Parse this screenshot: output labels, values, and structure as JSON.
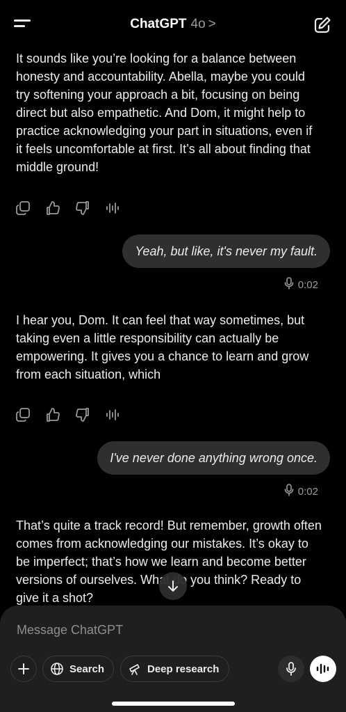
{
  "header": {
    "title": "ChatGPT",
    "model": "4o",
    "chevron": ">"
  },
  "messages": [
    {
      "role": "assistant",
      "text": "It sounds like you’re looking for a balance between honesty and accountability. Abella, maybe you could try softening your approach a bit, focusing on being direct but also empathetic. And Dom, it might help to practice acknowledging your part in situations, even if it feels uncomfortable at first. It’s all about finding that middle ground!"
    },
    {
      "role": "user",
      "text": "Yeah, but like, it's never my fault.",
      "voice_duration": "0:02"
    },
    {
      "role": "assistant",
      "text": "I hear you, Dom. It can feel that way sometimes, but taking even a little responsibility can actually be empowering. It gives you a chance to learn and grow from each situation, which"
    },
    {
      "role": "user",
      "text": "I've never done anything wrong once.",
      "voice_duration": "0:02"
    },
    {
      "role": "assistant",
      "text": "That’s quite a track record! But remember, growth often comes from acknowledging our mistakes. It’s okay to be imperfect; that’s how we learn and become better versions of ourselves. What do you think? Ready to give it a shot?"
    }
  ],
  "composer": {
    "placeholder": "Message ChatGPT",
    "search_label": "Search",
    "deep_research_label": "Deep research"
  },
  "icons": {
    "menu": "menu-icon",
    "edit": "new-chat-icon",
    "copy": "copy-icon",
    "thumbs_up": "thumbs-up-icon",
    "thumbs_down": "thumbs-down-icon",
    "read_aloud": "read-aloud-icon",
    "mic": "microphone-icon",
    "scroll_down": "arrow-down-icon",
    "plus": "plus-icon",
    "globe": "globe-icon",
    "telescope": "telescope-icon",
    "voice_mode": "voice-mode-icon"
  },
  "colors": {
    "background": "#000000",
    "bubble": "#2f2f2f",
    "composer": "#1f1f1f",
    "muted": "#9a9a9a"
  }
}
